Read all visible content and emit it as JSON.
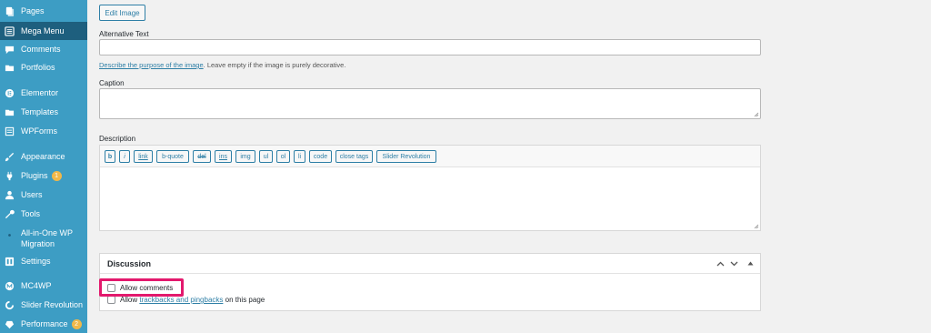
{
  "sidebar": {
    "items": [
      {
        "label": "Pages",
        "icon": "pages-icon"
      },
      {
        "label": "Mega Menu",
        "icon": "mega-menu-icon"
      },
      {
        "label": "Comments",
        "icon": "comments-icon"
      },
      {
        "label": "Portfolios",
        "icon": "portfolio-icon"
      },
      {
        "label": "Elementor",
        "icon": "elementor-icon"
      },
      {
        "label": "Templates",
        "icon": "templates-icon"
      },
      {
        "label": "WPForms",
        "icon": "wpforms-icon"
      },
      {
        "label": "Appearance",
        "icon": "appearance-icon"
      },
      {
        "label": "Plugins",
        "icon": "plugins-icon",
        "badge": "1"
      },
      {
        "label": "Users",
        "icon": "users-icon"
      },
      {
        "label": "Tools",
        "icon": "tools-icon"
      },
      {
        "label": "All-in-One WP Migration",
        "icon": "migration-icon"
      },
      {
        "label": "Settings",
        "icon": "settings-icon"
      },
      {
        "label": "MC4WP",
        "icon": "mc4wp-icon"
      },
      {
        "label": "Slider Revolution",
        "icon": "slider-revolution-icon"
      },
      {
        "label": "Performance",
        "icon": "performance-icon",
        "badge": "2"
      }
    ]
  },
  "main": {
    "edit_image_label": "Edit Image",
    "alt_text_label": "Alternative Text",
    "alt_text_value": "",
    "alt_help_link": "Describe the purpose of the image",
    "alt_help_rest": ". Leave empty if the image is purely decorative.",
    "caption_label": "Caption",
    "caption_value": "",
    "description_label": "Description",
    "description_value": "",
    "quicktags": [
      "b",
      "i",
      "link",
      "b-quote",
      "del",
      "ins",
      "img",
      "ul",
      "ol",
      "li",
      "code",
      "close tags",
      "Slider Revolution"
    ]
  },
  "discussion": {
    "title": "Discussion",
    "allow_comments_label": "Allow comments",
    "allow_comments_checked": false,
    "trackbacks_prefix": "Allow ",
    "trackbacks_link": "trackbacks and pingbacks",
    "trackbacks_suffix": " on this page",
    "trackbacks_checked": false
  },
  "colors": {
    "sidebar": "#3d9dc4",
    "accent": "#2e7fa6",
    "highlight": "#e3196d"
  }
}
